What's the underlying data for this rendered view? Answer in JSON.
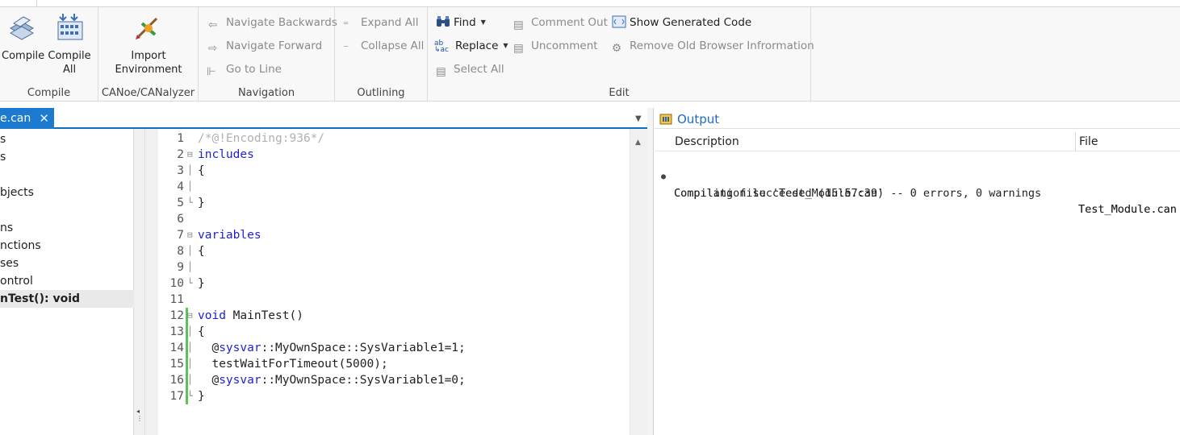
{
  "ribbon": {
    "compile_group": {
      "label": "Compile",
      "compile": "Compile",
      "compile_all_line1": "Compile",
      "compile_all_line2": "All"
    },
    "canoe_group": {
      "label": "CANoe/CANalyzer",
      "import_line1": "Import",
      "import_line2": "Environment"
    },
    "navigation_group": {
      "label": "Navigation",
      "backwards": "Navigate Backwards",
      "forward": "Navigate Forward",
      "goto_line": "Go to Line"
    },
    "outlining_group": {
      "label": "Outlining",
      "expand_all": "Expand All",
      "collapse_all": "Collapse All"
    },
    "edit_group": {
      "label": "Edit",
      "find": "Find",
      "replace": "Replace",
      "select_all": "Select All",
      "comment_out": "Comment Out",
      "uncomment": "Uncomment",
      "show_generated_code": "Show Generated Code",
      "remove_old_browser_info": "Remove Old Browser Infrormation"
    }
  },
  "editor_tab": {
    "label": "e.can",
    "close": "✕"
  },
  "tree": {
    "items": [
      "s",
      "s",
      "bjects",
      "ns",
      "nctions",
      "ses",
      "ontrol",
      "nTest(): void"
    ]
  },
  "code": {
    "lines": [
      {
        "n": "1",
        "comment": "/*@!Encoding:936*/"
      },
      {
        "n": "2",
        "kw": "includes"
      },
      {
        "n": "3",
        "plain": "{"
      },
      {
        "n": "4",
        "plain": ""
      },
      {
        "n": "5",
        "plain": "}"
      },
      {
        "n": "6",
        "plain": ""
      },
      {
        "n": "7",
        "kw": "variables"
      },
      {
        "n": "8",
        "plain": "{"
      },
      {
        "n": "9",
        "plain": ""
      },
      {
        "n": "10",
        "plain": "}"
      },
      {
        "n": "11",
        "plain": ""
      },
      {
        "n": "12",
        "kw": "void",
        "rest": " MainTest()"
      },
      {
        "n": "13",
        "plain": "{"
      },
      {
        "n": "14",
        "pre": "  @",
        "kw": "sysvar",
        "rest": "::MyOwnSpace::SysVariable1=1;"
      },
      {
        "n": "15",
        "plain": "  testWaitForTimeout(5000);"
      },
      {
        "n": "16",
        "pre": "  @",
        "kw": "sysvar",
        "rest": "::MyOwnSpace::SysVariable1=0;"
      },
      {
        "n": "17",
        "plain": "}"
      }
    ]
  },
  "output": {
    "title": "Output",
    "col_description": "Description",
    "col_file": "File",
    "rows": [
      {
        "description": "Compiling file 'Test_Module.can'",
        "file": "Test_Module.can"
      },
      {
        "description": "Compilation succeeded (15:57:39) -- 0 errors, 0 warnings",
        "file": "Test_Module.can"
      }
    ]
  },
  "colors": {
    "accent": "#1c7bd0",
    "keyword": "#1f1fd1",
    "comment": "#b0b0b0",
    "change_bar": "#5cc25c"
  }
}
